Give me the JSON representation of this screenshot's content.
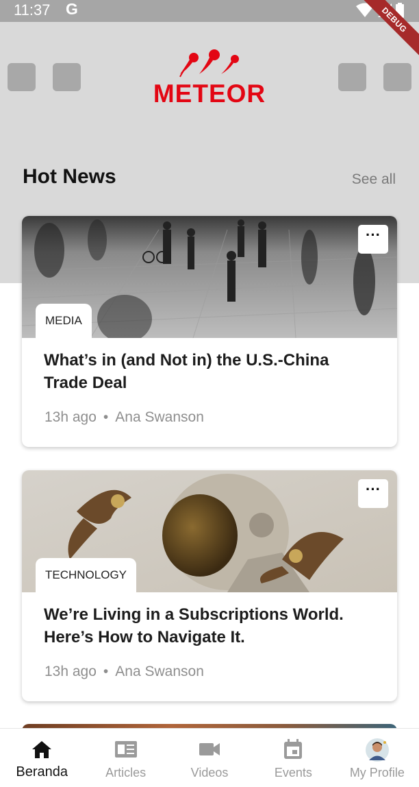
{
  "status_bar": {
    "time": "11:37",
    "g_label": "G"
  },
  "debug_label": "DEBUG",
  "header": {
    "logo_text": "METEOR",
    "brand_color": "#e30613"
  },
  "section": {
    "title": "Hot News",
    "see_all": "See all"
  },
  "articles": [
    {
      "category": "MEDIA",
      "title": "What’s in (and Not in) the U.S.-China Trade Deal",
      "time": "13h ago",
      "author": "Ana Swanson",
      "more_label": "···"
    },
    {
      "category": "TECHNOLOGY",
      "title": "We’re Living in a Subscriptions World. Here’s How to Navigate It.",
      "time": "13h ago",
      "author": "Ana Swanson",
      "more_label": "···"
    }
  ],
  "bottom_nav": [
    {
      "label": "Beranda",
      "icon": "home-icon",
      "active": true
    },
    {
      "label": "Articles",
      "icon": "article-icon",
      "active": false
    },
    {
      "label": "Videos",
      "icon": "video-icon",
      "active": false
    },
    {
      "label": "Events",
      "icon": "calendar-icon",
      "active": false
    },
    {
      "label": "My Profile",
      "icon": "avatar-icon",
      "active": false
    }
  ]
}
